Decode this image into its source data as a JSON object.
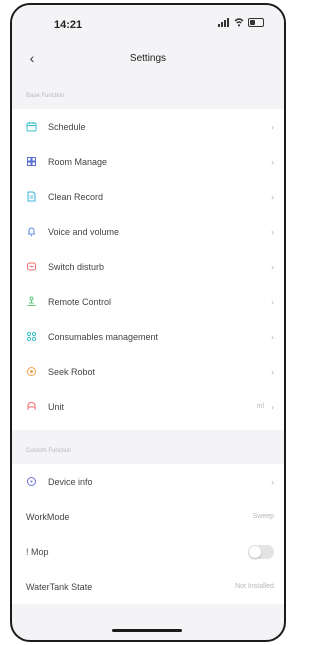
{
  "status_bar": {
    "time": "14:21"
  },
  "header": {
    "back_icon": "chevron-left-icon",
    "title": "Settings"
  },
  "sections": {
    "base": {
      "label": "Base Function"
    },
    "custom": {
      "label": "Custom Function"
    }
  },
  "base_items": [
    {
      "label": "Schedule",
      "icon": "calendar-icon",
      "color": "#3bbfc9"
    },
    {
      "label": "Room Manage",
      "icon": "room-icon",
      "color": "#5b6fd6"
    },
    {
      "label": "Clean Record",
      "icon": "document-icon",
      "color": "#3bb3e0"
    },
    {
      "label": "Voice and volume",
      "icon": "bell-icon",
      "color": "#5b8fe0"
    },
    {
      "label": "Switch disturb",
      "icon": "do-not-disturb-icon",
      "color": "#f06b6b"
    },
    {
      "label": "Remote Control",
      "icon": "remote-control-icon",
      "color": "#5bc97a"
    },
    {
      "label": "Consumables management",
      "icon": "consumables-icon",
      "color": "#3bbfc9"
    },
    {
      "label": "Seek Robot",
      "icon": "seek-robot-icon",
      "color": "#f0a04b"
    },
    {
      "label": "Unit",
      "icon": "unit-icon",
      "color": "#f06b6b",
      "value": "ml"
    }
  ],
  "custom_items": [
    {
      "label": "Device info",
      "icon": "info-icon",
      "color": "#6b6fd6"
    },
    {
      "label": "WorkMode",
      "value": "Sweep"
    },
    {
      "label": "! Mop",
      "toggle": false
    },
    {
      "label": "WaterTank State",
      "value": "Not Installed"
    }
  ]
}
